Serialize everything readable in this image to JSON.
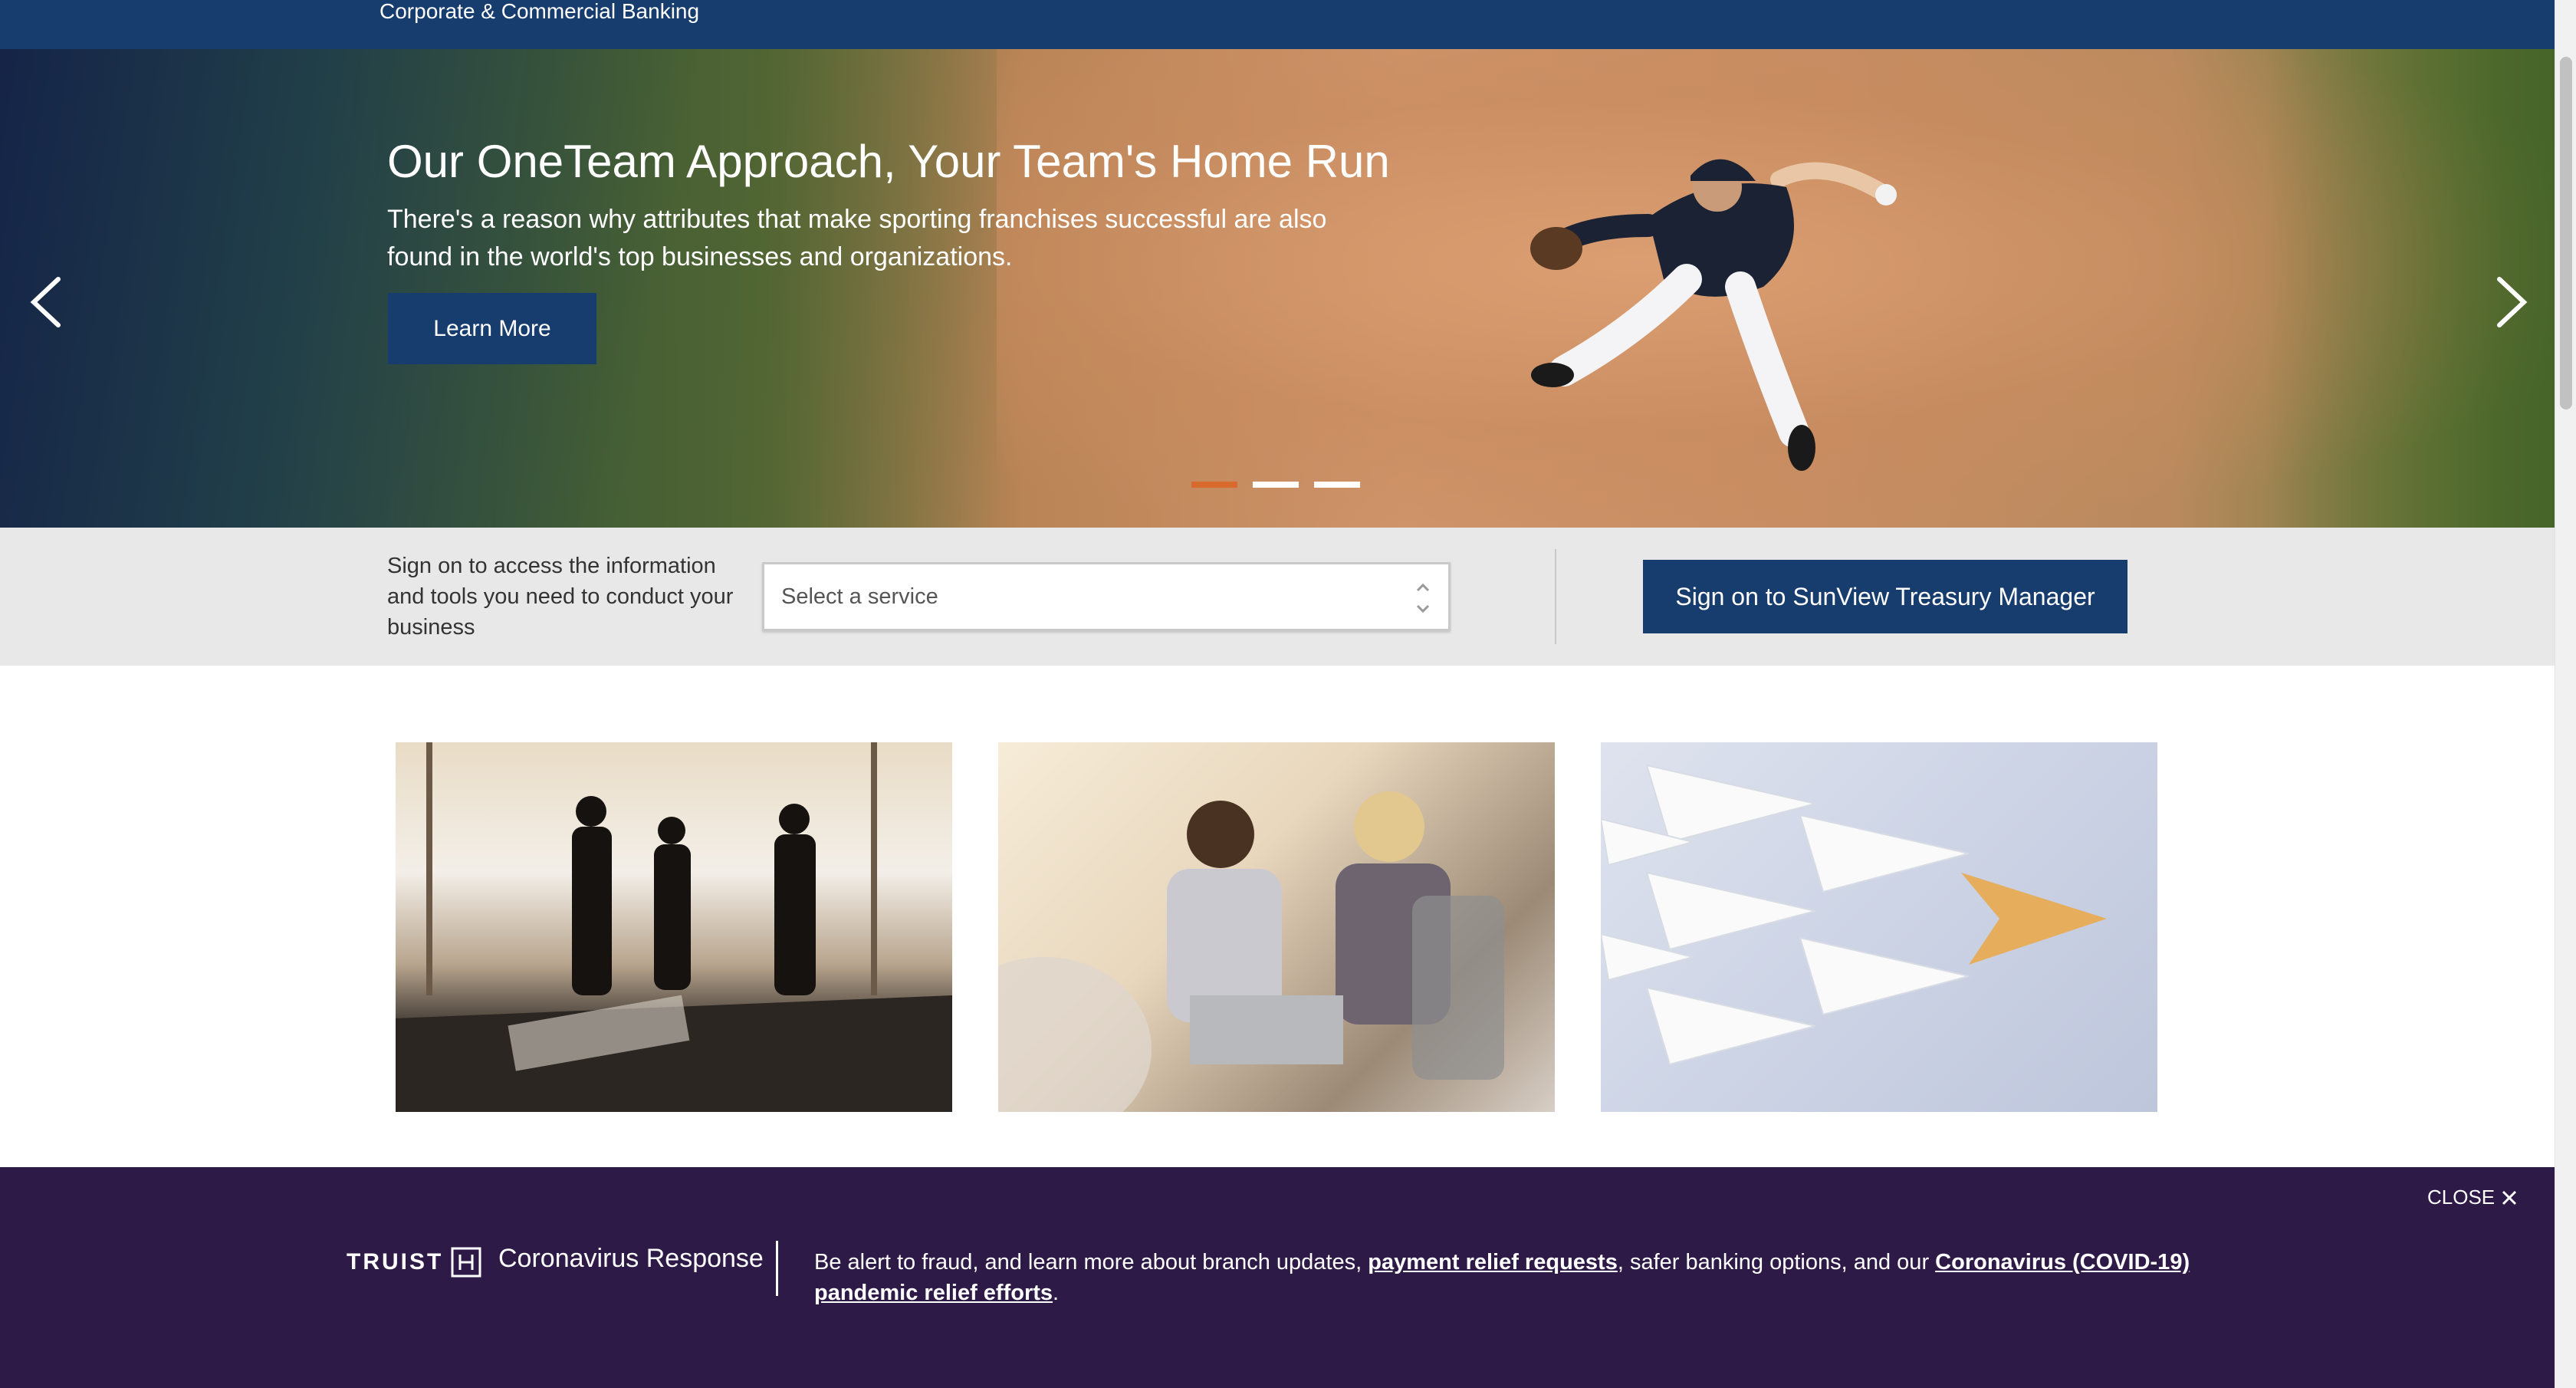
{
  "header": {
    "section_title": "Corporate & Commercial Banking"
  },
  "hero": {
    "headline": "Our OneTeam Approach, Your Team's Home Run",
    "subtext": "There's a reason why attributes that make sporting franchises successful are also found in the world's top businesses and organizations.",
    "cta_label": "Learn More",
    "carousel": {
      "slide_count": 3,
      "active_index": 0
    }
  },
  "signon": {
    "prompt": "Sign on to access the information and tools you need to conduct your business",
    "select_value": "Select a service",
    "button_label": "Sign on to SunView Treasury Manager"
  },
  "banner": {
    "close_label": "CLOSE",
    "brand_word": "TRUIST",
    "brand_sub": "Coronavirus Response",
    "msg_part1": "Be alert to fraud, and learn more about branch updates, ",
    "link1": "payment relief requests",
    "msg_part2": ", safer banking options, and our ",
    "link2": "Coronavirus (COVID-19) pandemic relief efforts",
    "msg_part3": "."
  },
  "colors": {
    "navy": "#173c6e",
    "banner_purple": "#2e1a47",
    "accent_orange": "#d86a2d",
    "strip_gray": "#e8e8e8"
  }
}
